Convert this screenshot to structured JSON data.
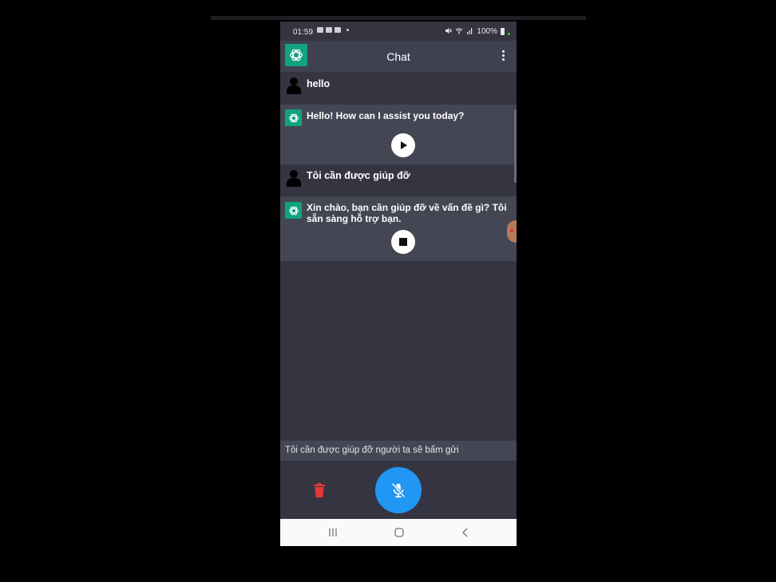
{
  "status_bar": {
    "time": "01:59",
    "battery": "100%"
  },
  "app_bar": {
    "title": "Chat"
  },
  "messages": [
    {
      "role": "user",
      "text": "hello"
    },
    {
      "role": "assistant",
      "text": "Hello! How can I assist you today?",
      "control": "play-icon"
    },
    {
      "role": "user",
      "text": "Tôi cần được giúp đỡ"
    },
    {
      "role": "assistant",
      "text": "Xin chào, bạn cần giúp đỡ về vấn đề gì? Tôi sẵn sàng hỗ trợ bạn.",
      "control": "stop-icon"
    }
  ],
  "input": {
    "value": "Tôi cần được giúp đỡ người ta sẽ bấm gửi"
  },
  "colors": {
    "background": "#343541",
    "bot_bubble": "#444654",
    "brand": "#10a37f",
    "mic_button": "#2196f3",
    "delete": "#e53935"
  },
  "icons": {
    "logo": "openai-logo-icon",
    "menu": "more-vert-icon",
    "user": "person-icon",
    "delete": "trash-icon",
    "mic": "mic-off-icon",
    "nav": [
      "recent-apps-icon",
      "home-icon",
      "back-icon"
    ]
  }
}
